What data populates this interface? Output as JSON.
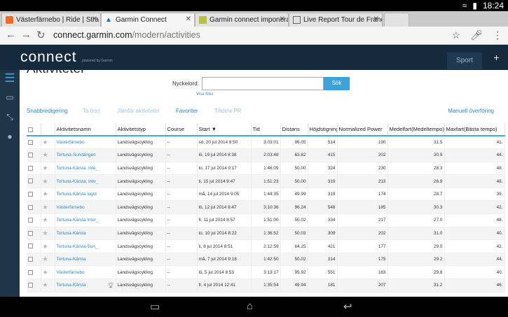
{
  "status": {
    "time": "18:24"
  },
  "tabs": [
    {
      "title": "Västerfärnebo | Ride | Stra",
      "active": false
    },
    {
      "title": "Garmin Connect",
      "active": true
    },
    {
      "title": "Garmin connect imponerar",
      "active": false
    },
    {
      "title": "Live Report Tour de France",
      "active": false
    }
  ],
  "url": {
    "host": "connect.garmin.com",
    "path": "/modern/activities"
  },
  "header": {
    "logo": "connect",
    "powered": "powered by Garmin",
    "sport": "Sport",
    "plus": "+"
  },
  "page": {
    "title": "Aktiviteter"
  },
  "search": {
    "label": "Nyckelord:",
    "value": "",
    "button": "Sök",
    "filter_link": "Visa filter"
  },
  "actions": {
    "quick_edit": "Snabbredigering",
    "remove": "Ta bort",
    "compare": "Jämför aktiviteter",
    "favorites": "Favoriter",
    "assign_pr": "Tilldela PR",
    "manual_transfer": "Manuell överföring"
  },
  "table": {
    "columns": [
      "Aktivitetsnamn",
      "Aktivitetstyp",
      "Course",
      "Start",
      "Tid",
      "Distans",
      "Höjdstigning",
      "Normalized Power",
      "Medelfart(Medeltempo)",
      "Maxfart(Bästa tempo)"
    ],
    "rows": [
      {
        "name": "Västerfärnebo",
        "type": "Landsvägscykling",
        "course": "--",
        "start": "sö, 20 jul 2014 8:50",
        "time": "3:03:01",
        "dist": "96.05",
        "elev": "514",
        "np": "190",
        "avg": "31.5",
        "max": "41."
      },
      {
        "name": "Tortuna-Sundängen",
        "type": "Landsvägscykling",
        "course": "--",
        "start": "lö, 19 jul 2014 8:38",
        "time": "2:03:48",
        "dist": "63.82",
        "elev": "415",
        "np": "202",
        "avg": "30.9",
        "max": "44."
      },
      {
        "name": "Tortuna-Kärsta, Inte_",
        "type": "Landsvägscykling",
        "course": "--",
        "start": "to, 17 jul 2014 9:17",
        "time": "1:46:09",
        "dist": "50.00",
        "elev": "324",
        "np": "230",
        "avg": "28.3",
        "max": "48."
      },
      {
        "name": "Tortuna-Kärsta, Inte_",
        "type": "Landsvägscykling",
        "course": "--",
        "start": "ti, 15 jul 2014 9:47",
        "time": "1:51:23",
        "dist": "50.00",
        "elev": "319",
        "np": "213",
        "avg": "26.9",
        "max": "48."
      },
      {
        "name": "Tortuna-Kärsta lugnt",
        "type": "Landsvägscykling",
        "course": "--",
        "start": "må, 14 jul 2014 9:05",
        "time": "1:44:35",
        "dist": "49.99",
        "elev": "319",
        "np": "174",
        "avg": "28.7",
        "max": "39."
      },
      {
        "name": "Västerfärnebo",
        "type": "Landsvägscykling",
        "course": "--",
        "start": "lö, 12 jul 2014 8:47",
        "time": "3:10:36",
        "dist": "96.24",
        "elev": "548",
        "np": "185",
        "avg": "30.3",
        "max": "42."
      },
      {
        "name": "Tortuna-Kärsta Inter_",
        "type": "Landsvägscykling",
        "course": "--",
        "start": "fr, 11 jul 2014 8:57",
        "time": "1:51:00",
        "dist": "50.02",
        "elev": "334",
        "np": "217",
        "avg": "27.0",
        "max": "48."
      },
      {
        "name": "Tortuna-Kärsta",
        "type": "Landsvägscykling",
        "course": "--",
        "start": "to, 10 jul 2014 8:22",
        "time": "1:36:52",
        "dist": "50.03",
        "elev": "309",
        "np": "202",
        "avg": "31.0",
        "max": "40."
      },
      {
        "name": "Tortuna-Kärsta-Sun_",
        "type": "Landsvägscykling",
        "course": "--",
        "start": "ti, 8 jul 2014 8:51",
        "time": "2:12:59",
        "dist": "64.25",
        "elev": "421",
        "np": "177",
        "avg": "29.0",
        "max": "42."
      },
      {
        "name": "Tortuna-Kärsta",
        "type": "Landsvägscykling",
        "course": "--",
        "start": "må, 7 jul 2014 9:18",
        "time": "1:42:50",
        "dist": "50.02",
        "elev": "314",
        "np": "175",
        "avg": "29.2",
        "max": "44."
      },
      {
        "name": "Västerfärnebo",
        "type": "Landsvägscykling",
        "course": "--",
        "start": "lö, 5 jul 2014 8:53",
        "time": "3:13:17",
        "dist": "95.92",
        "elev": "551",
        "np": "183",
        "avg": "29.8",
        "max": "40."
      },
      {
        "name": "Tortuna-Kärsta",
        "type": "Landsvägscykling",
        "course": "--",
        "start": "fr, 4 jul 2014 12:41",
        "time": "1:35:54",
        "dist": "49.94",
        "elev": "181",
        "np": "207",
        "avg": "31.2",
        "max": "46."
      }
    ]
  }
}
